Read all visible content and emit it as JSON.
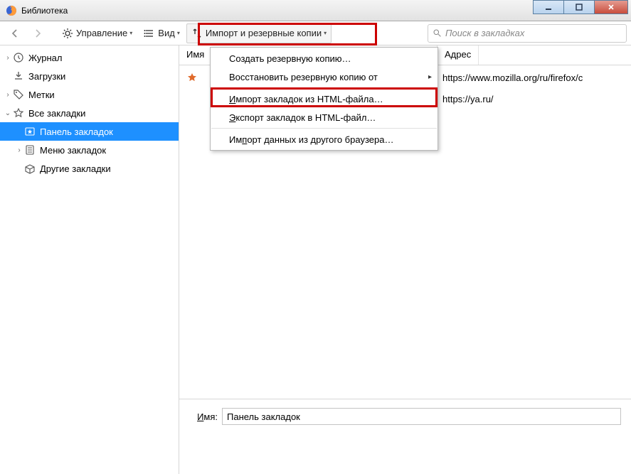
{
  "window": {
    "title": "Библиотека"
  },
  "toolbar": {
    "manage": "Управление",
    "view": "Вид",
    "import": "Импорт и резервные копии"
  },
  "search": {
    "placeholder": "Поиск в закладках"
  },
  "sidebar": {
    "history": "Журнал",
    "downloads": "Загрузки",
    "tags": "Метки",
    "allbm": "Все закладки",
    "toolbar_bm": "Панель закладок",
    "menu_bm": "Меню закладок",
    "other_bm": "Другие закладки"
  },
  "columns": {
    "name": "Имя",
    "addr": "Адрес"
  },
  "rows": [
    {
      "addr": "https://www.mozilla.org/ru/firefox/c"
    },
    {
      "addr": "https://ya.ru/"
    }
  ],
  "menu": {
    "backup": "Создать резервную копию…",
    "restore": "Восстановить резервную копию от",
    "import_html_pre": "Импорт закладок из HTML-файла…",
    "export_html_pre": "Экспорт закладок в HTML-файл…",
    "import_browser_pre": "Импорт данных из другого браузера…"
  },
  "details": {
    "name_label_pre": "Имя:",
    "name_value": "Панель закладок"
  }
}
